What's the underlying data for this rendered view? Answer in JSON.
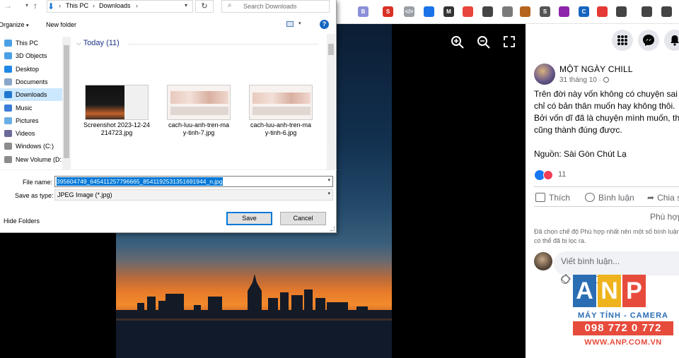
{
  "browser": {
    "extensions": [
      {
        "icon": "b-icon",
        "text": "B",
        "color": "#8a8fd8"
      },
      {
        "icon": "s-icon",
        "text": "S",
        "color": "#d93025"
      },
      {
        "icon": "code-icon",
        "text": "</>",
        "color": "#9aa0a6"
      },
      {
        "icon": "circle-icon",
        "text": "",
        "color": "#1a73e8"
      },
      {
        "icon": "m-icon",
        "text": "M",
        "color": "#333333"
      },
      {
        "icon": "tag-icon",
        "text": "",
        "color": "#e8453c"
      },
      {
        "icon": "person-icon",
        "text": "",
        "color": "#444444"
      },
      {
        "icon": "grid-icon",
        "text": "",
        "color": "#7a7a7a"
      },
      {
        "icon": "cookie-icon",
        "text": "",
        "color": "#b5651d"
      },
      {
        "icon": "s2-icon",
        "text": "S",
        "color": "#555555"
      },
      {
        "icon": "purple-icon",
        "text": "",
        "color": "#8e24aa"
      },
      {
        "icon": "c-icon",
        "text": "C",
        "color": "#1565c0"
      },
      {
        "icon": "red-icon",
        "text": "",
        "color": "#e53935"
      },
      {
        "icon": "puzzle-icon",
        "text": "",
        "color": "#444444"
      },
      {
        "icon": "list-icon",
        "text": "",
        "color": "#444444"
      },
      {
        "icon": "sidepanel-icon",
        "text": "",
        "color": "#444444"
      }
    ]
  },
  "dialog": {
    "breadcrumb": [
      "This PC",
      "Downloads"
    ],
    "search_placeholder": "Search Downloads",
    "organize_label": "Organize",
    "new_folder_label": "New folder",
    "nav_items": [
      {
        "label": "This PC",
        "icon": "pc-icon",
        "color": "#4aa0e6"
      },
      {
        "label": "3D Objects",
        "icon": "cube-icon",
        "color": "#4aa0e6"
      },
      {
        "label": "Desktop",
        "icon": "desktop-icon",
        "color": "#1e88e5"
      },
      {
        "label": "Documents",
        "icon": "documents-icon",
        "color": "#8aa6c8"
      },
      {
        "label": "Downloads",
        "icon": "download-icon",
        "color": "#1e78d0"
      },
      {
        "label": "Music",
        "icon": "music-icon",
        "color": "#3b7dd8"
      },
      {
        "label": "Pictures",
        "icon": "pictures-icon",
        "color": "#6aaee6"
      },
      {
        "label": "Videos",
        "icon": "videos-icon",
        "color": "#6a6a9a"
      },
      {
        "label": "Windows (C:)",
        "icon": "drive-icon",
        "color": "#8c8c8c"
      },
      {
        "label": "New Volume (D:",
        "icon": "drive2-icon",
        "color": "#8c8c8c"
      }
    ],
    "group_title": "Today (11)",
    "files": [
      {
        "name_l1": "Screenshot 2023-12-24",
        "name_l2": "214723.jpg"
      },
      {
        "name_l1": "cach-luu-anh-tren-ma",
        "name_l2": "y-tinh-7.jpg"
      },
      {
        "name_l1": "cach-luu-anh-tren-ma",
        "name_l2": "y-tinh-6.jpg"
      }
    ],
    "file_name_label": "File name:",
    "file_name_value": "395604749_645411257796665_8541192531351691944_n.jpg",
    "save_type_label": "Save as type:",
    "save_type_value": "JPEG Image (*.jpg)",
    "hide_folders_label": "Hide Folders",
    "save_label": "Save",
    "cancel_label": "Cancel"
  },
  "facebook": {
    "author": "MỘT NGÀY CHILL",
    "date": "31 tháng 10 ·",
    "body": [
      "Trên đời này vốn không có chuyện sai ha",
      "chỉ có bản thân muốn hay không thôi.",
      "Bởi vốn dĩ đã là chuyện mình muốn, thì c",
      "cũng thành đúng được.",
      "",
      "Nguồn: Sài Gòn Chút Lạ"
    ],
    "reaction_count": "11",
    "like_label": "Thích",
    "comment_label": "Bình luận",
    "share_label": "Chia s",
    "filter_label": "Phù hợp",
    "filter_note": "Đã chọn chế độ Phù hợp nhất nên một số bình luận có thể đã bị lọc ra.",
    "comment_placeholder": "Viết bình luận..."
  },
  "watermark": {
    "letters": [
      "A",
      "N",
      "P"
    ],
    "line1": "MÁY TÍNH - CAMERA",
    "line2": "098 772 0 772",
    "line3": "WWW.ANP.COM.VN"
  }
}
